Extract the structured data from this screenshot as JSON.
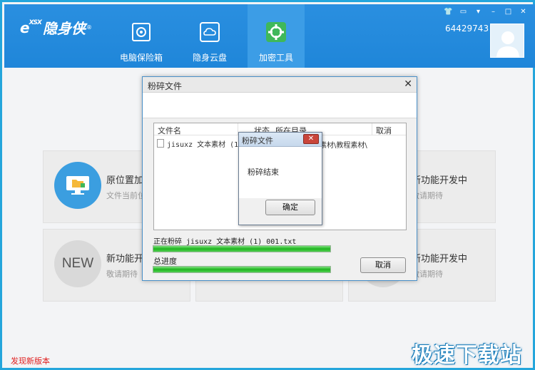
{
  "app": {
    "logo_mark": "e",
    "logo_small": "XSX",
    "logo_text": "隐身侠",
    "logo_reg": "®",
    "user_id": "64429743",
    "nav": [
      {
        "label": "电脑保险箱",
        "icon": "safe-icon"
      },
      {
        "label": "隐身云盘",
        "icon": "cloud-icon"
      },
      {
        "label": "加密工具",
        "icon": "tools-icon"
      }
    ],
    "window_controls": [
      "👕",
      "▭",
      "▾",
      "–",
      "□",
      "✕"
    ]
  },
  "cards": [
    {
      "title": "原位置加密",
      "sub": "文件当前位置",
      "icon": "computer-folder-icon"
    },
    {
      "title": "新功能开发中",
      "sub": "敬请期待",
      "icon": ""
    },
    {
      "title": "新功能开发中",
      "sub": "敬请期待",
      "icon": "new-badge-icon",
      "badge": "NEW"
    },
    {
      "title": "新功能开发中",
      "sub": "敬请期待",
      "icon": ""
    }
  ],
  "footer": {
    "new_version": "发现新版本",
    "watermark": "极速下载站"
  },
  "dialog": {
    "title": "粉碎文件",
    "close": "✕",
    "columns": [
      "文件名",
      "状态",
      "所在目录",
      "取消"
    ],
    "rows": [
      {
        "file": "jisuxz 文本素材 (1 已",
        "dir": "素材\\教程素材\\"
      }
    ],
    "current_label": "正在粉碎 jisuxz 文本素材 (1)_001.txt",
    "current_progress": 1.0,
    "total_label": "总进度",
    "total_progress": 1.0,
    "cancel_button": "取消"
  },
  "popup": {
    "title": "粉碎文件",
    "close": "✕",
    "message": "粉碎结束",
    "ok_button": "确定"
  },
  "colors": {
    "header": "#1f86d9",
    "progress": "#1fb51f",
    "new_version": "#e02020"
  }
}
